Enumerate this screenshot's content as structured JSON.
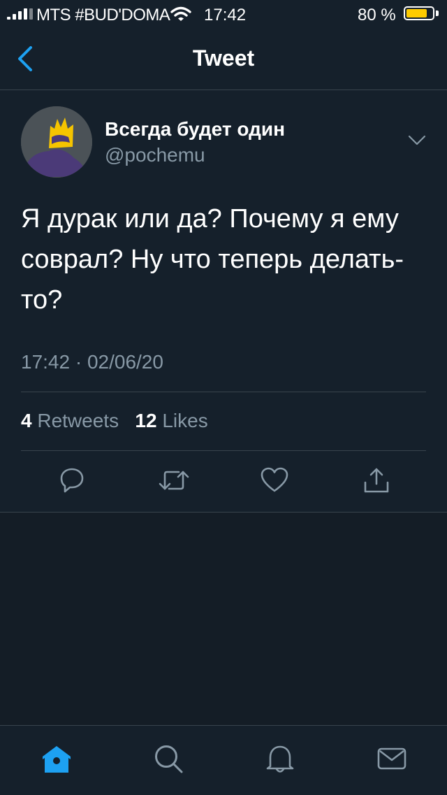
{
  "status_bar": {
    "carrier": "MTS #BUD'DOMA",
    "time": "17:42",
    "battery_percent": "80 %",
    "battery_level": 0.8,
    "icons": [
      "signal-icon",
      "wifi-icon",
      "battery-icon"
    ]
  },
  "nav": {
    "back_icon": "chevron-left-icon",
    "title": "Tweet"
  },
  "tweet": {
    "author_name": "Всегда будет один",
    "author_handle": "@pochemu",
    "text": "Я дурак или да? Почему я ему соврал? Ну что теперь делать-то?",
    "timestamp": "17:42 · 02/06/20",
    "retweet_count": "4",
    "retweet_label": "Retweets",
    "like_count": "12",
    "like_label": "Likes",
    "actions": [
      "reply-icon",
      "retweet-icon",
      "like-icon",
      "share-icon"
    ]
  },
  "tab_bar": {
    "tabs": [
      "home-icon",
      "search-icon",
      "notifications-icon",
      "messages-icon"
    ]
  },
  "colors": {
    "background": "#141d26",
    "surface": "#15202b",
    "accent": "#1da1f2",
    "secondary_text": "#8899a6",
    "divider": "#38444d",
    "battery": "#ffcc00"
  }
}
